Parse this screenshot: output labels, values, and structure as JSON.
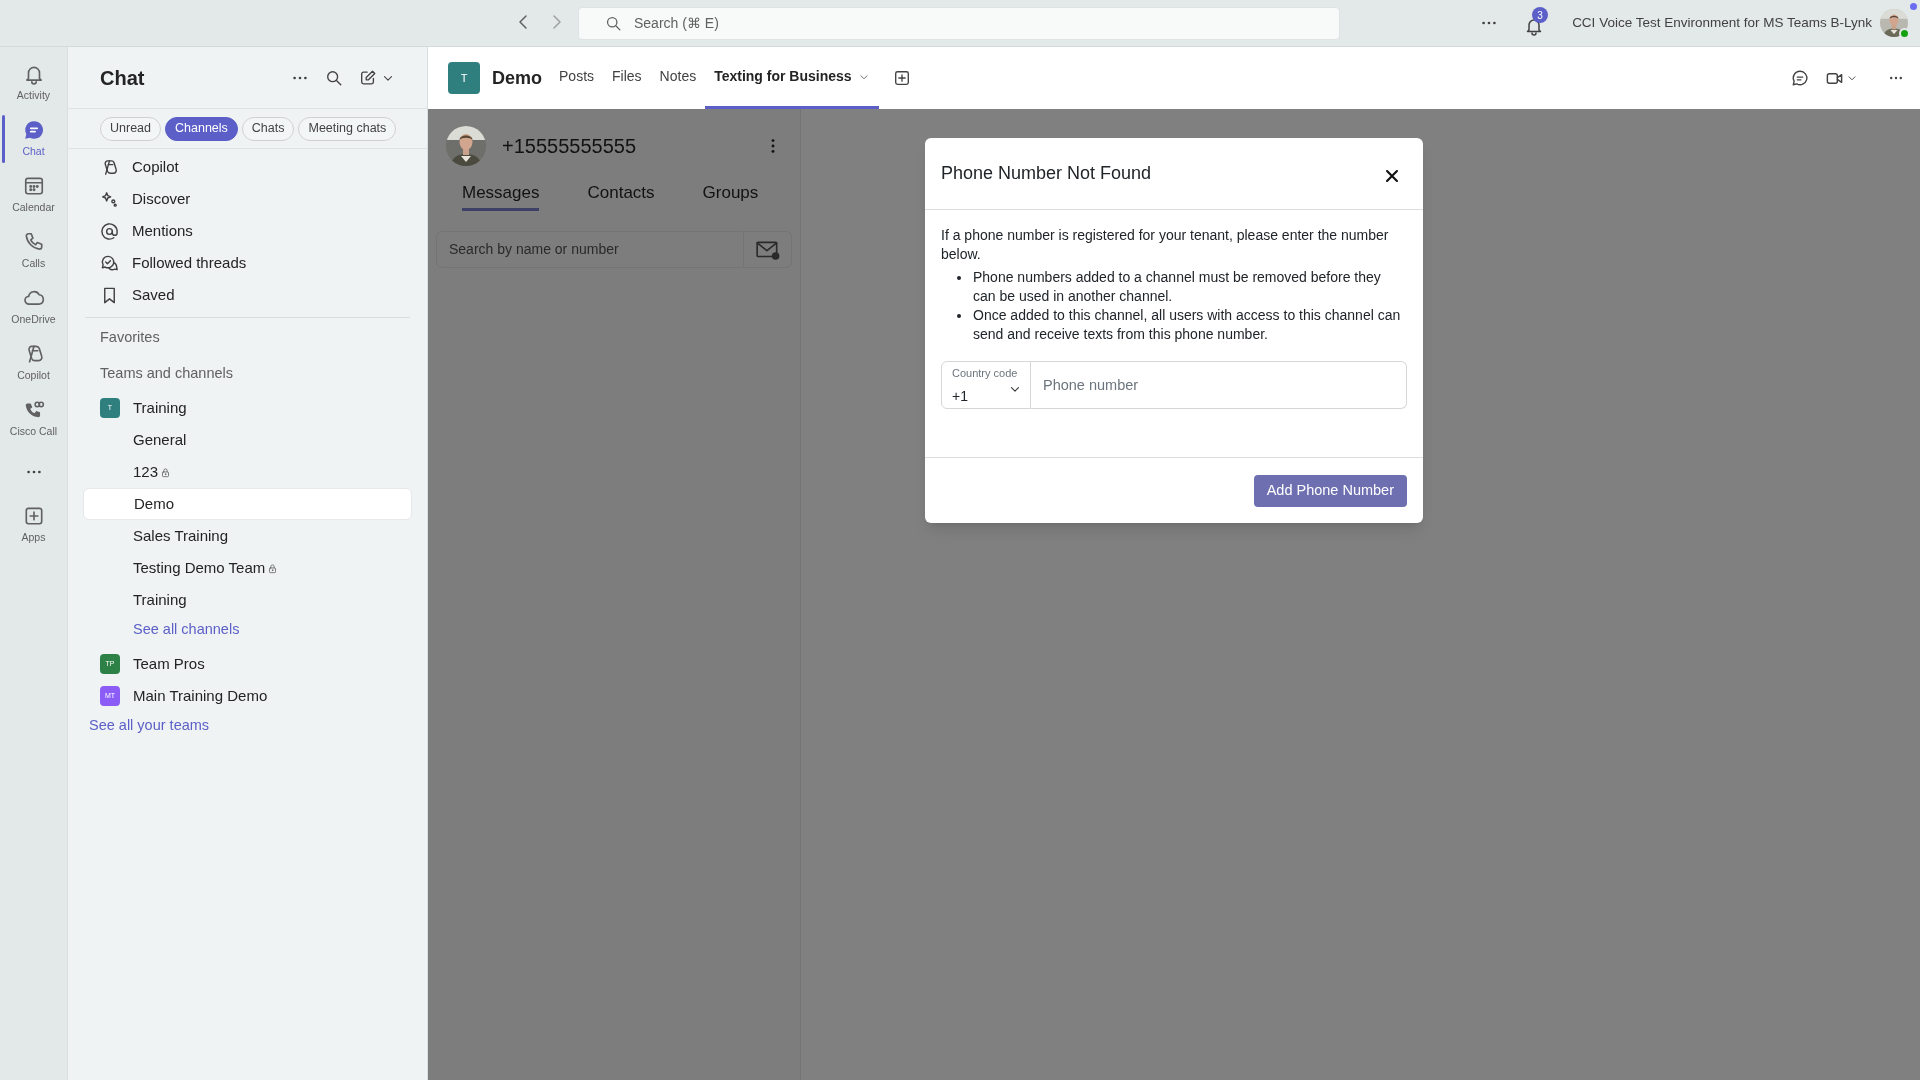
{
  "top_bar": {
    "search_placeholder": "Search (⌘ E)",
    "notification_count": "3",
    "org_name": "CCI Voice Test Environment for MS Teams B-Lynk"
  },
  "rail": [
    {
      "label": "Activity",
      "selected": false
    },
    {
      "label": "Chat",
      "selected": true
    },
    {
      "label": "Calendar",
      "selected": false
    },
    {
      "label": "Calls",
      "selected": false
    },
    {
      "label": "OneDrive",
      "selected": false
    },
    {
      "label": "Copilot",
      "selected": false
    },
    {
      "label": "Cisco Call",
      "selected": false
    },
    {
      "label": "Apps",
      "selected": false
    }
  ],
  "sidebar": {
    "title": "Chat",
    "filters": [
      {
        "label": "Unread",
        "selected": false
      },
      {
        "label": "Channels",
        "selected": true
      },
      {
        "label": "Chats",
        "selected": false
      },
      {
        "label": "Meeting chats",
        "selected": false
      }
    ],
    "nav_items": [
      {
        "label": "Copilot"
      },
      {
        "label": "Discover"
      },
      {
        "label": "Mentions"
      },
      {
        "label": "Followed threads"
      },
      {
        "label": "Saved"
      }
    ],
    "favorites_heading": "Favorites",
    "teams_heading": "Teams and channels",
    "teams": [
      {
        "initials": "T",
        "name": "Training",
        "color": "#2f7f7f",
        "children": [
          {
            "label": "General",
            "locked": false,
            "selected": false
          },
          {
            "label": "123",
            "locked": true,
            "selected": false
          },
          {
            "label": "Demo",
            "locked": false,
            "selected": true
          },
          {
            "label": "Sales Training",
            "locked": false,
            "selected": false
          },
          {
            "label": "Testing Demo Team",
            "locked": true,
            "selected": false
          },
          {
            "label": "Training",
            "locked": false,
            "selected": false
          }
        ],
        "see_all": "See all channels"
      },
      {
        "initials": "TP",
        "name": "Team Pros",
        "color": "#2e8146"
      },
      {
        "initials": "MT",
        "name": "Main Training Demo",
        "color": "#8b5cf6"
      }
    ],
    "see_all_teams": "See all your teams"
  },
  "channel_header": {
    "initial": "T",
    "name": "Demo",
    "tabs": [
      {
        "label": "Posts",
        "selected": false,
        "has_menu": false
      },
      {
        "label": "Files",
        "selected": false,
        "has_menu": false
      },
      {
        "label": "Notes",
        "selected": false,
        "has_menu": false
      },
      {
        "label": "Texting for Business",
        "selected": true,
        "has_menu": true
      }
    ]
  },
  "texting_panel": {
    "phone": "+15555555555",
    "tabs": [
      {
        "label": "Messages",
        "selected": true
      },
      {
        "label": "Contacts",
        "selected": false
      },
      {
        "label": "Groups",
        "selected": false
      }
    ],
    "search_placeholder": "Search by name or number"
  },
  "dialog": {
    "title": "Phone Number Not Found",
    "intro": "If a phone number is registered for your tenant, please enter the number below.",
    "bullets": [
      "Phone numbers added to a channel must be removed before they can be used in another channel.",
      "Once added to this channel, all users with access to this channel can send and receive texts from this phone number."
    ],
    "country_code_label": "Country code",
    "country_code": "+1",
    "phone_placeholder": "Phone number",
    "button": "Add Phone Number"
  }
}
